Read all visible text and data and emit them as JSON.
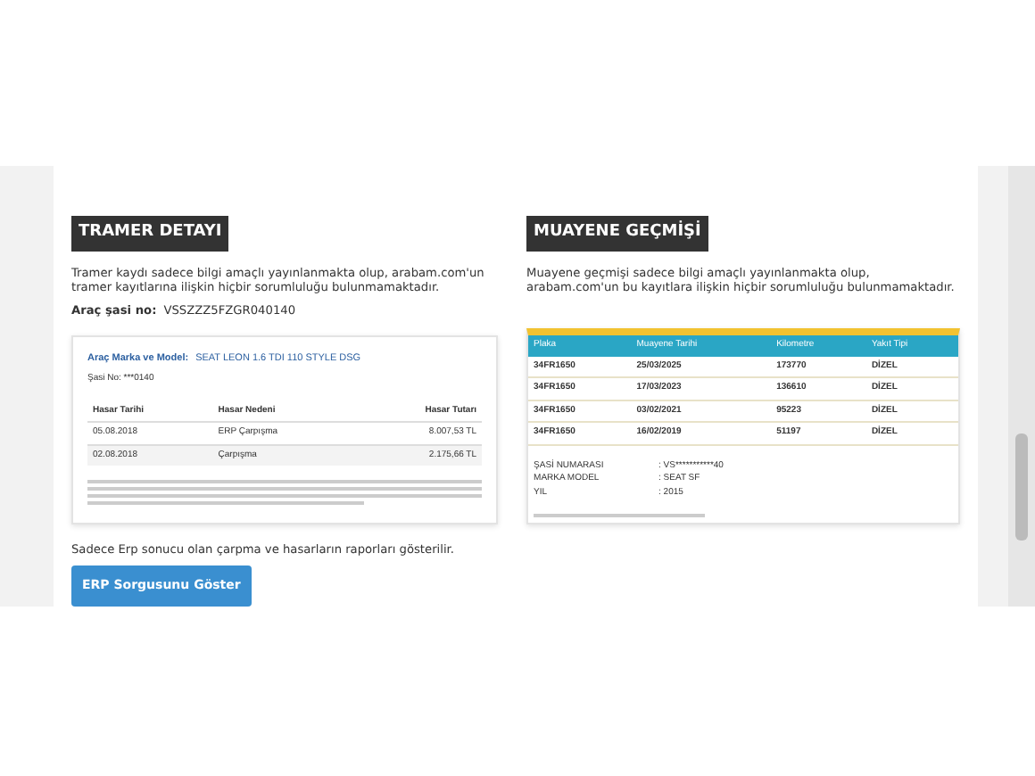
{
  "tramer": {
    "title": "TRAMER DETAYI",
    "notice": "Tramer kaydı sadece bilgi amaçlı yayınlanmakta olup, arabam.com'un tramer kayıtlarına ilişkin hiçbir sorumluluğu bulunmamaktadır.",
    "chassis_label": "Araç şasi no:",
    "chassis_value": "VSSZZZ5FZGR040140",
    "report": {
      "model_label": "Araç Marka ve Model:",
      "model_value": "SEAT LEON 1.6 TDI 110 STYLE DSG",
      "chassis_line": "Şasi No: ***0140",
      "columns": [
        "Hasar Tarihi",
        "Hasar Nedeni",
        "Hasar Tutarı"
      ],
      "rows": [
        [
          "05.08.2018",
          "ERP Çarpışma",
          "8.007,53 TL"
        ],
        [
          "02.08.2018",
          "Çarpışma",
          "2.175,66 TL"
        ]
      ]
    }
  },
  "muayene": {
    "title": "MUAYENE GEÇMİŞİ",
    "notice": "Muayene geçmişi sadece bilgi amaçlı yayınlanmakta olup, arabam.com'un bu kayıtlara ilişkin hiçbir sorumluluğu bulunmamaktadır.",
    "report": {
      "columns": [
        "Plaka",
        "Muayene Tarihi",
        "Kilometre",
        "Yakıt Tipi"
      ],
      "rows": [
        [
          "34FR1650",
          "25/03/2025",
          "173770",
          "DİZEL"
        ],
        [
          "34FR1650",
          "17/03/2023",
          "136610",
          "DİZEL"
        ],
        [
          "34FR1650",
          "03/02/2021",
          "95223",
          "DİZEL"
        ],
        [
          "34FR1650",
          "16/02/2019",
          "51197",
          "DİZEL"
        ]
      ],
      "info": [
        [
          "ŞASİ NUMARASI",
          ": VS***********40"
        ],
        [
          "MARKA MODEL",
          ": SEAT SF"
        ],
        [
          "YIL",
          ": 2015"
        ]
      ]
    }
  },
  "erp_note": "Sadece Erp sonucu olan çarpma ve hasarların raporları gösterilir.",
  "erp_button": "ERP Sorgusunu Göster"
}
